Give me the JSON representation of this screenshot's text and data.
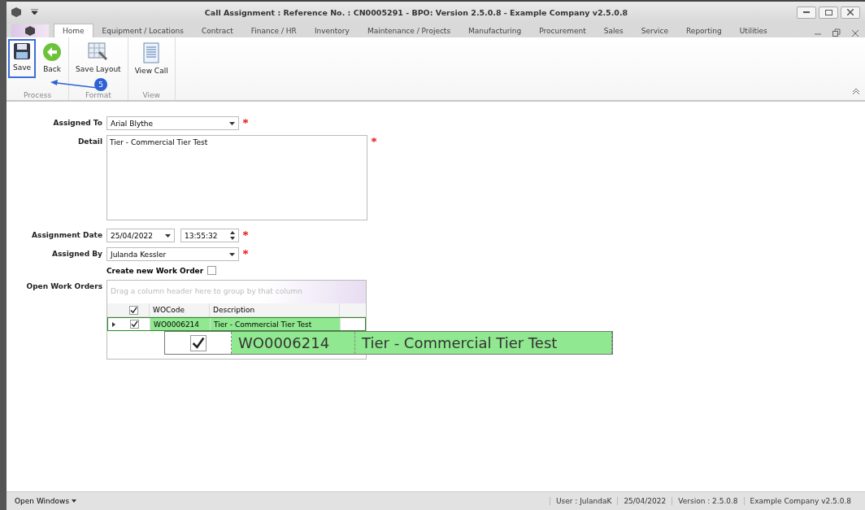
{
  "window": {
    "title": "Call Assignment : Reference No. : CN0005291 - BPO: Version 2.5.0.8 - Example Company v2.5.0.8"
  },
  "tabs": [
    {
      "label": "Home",
      "selected": true
    },
    {
      "label": "Equipment / Locations",
      "selected": false
    },
    {
      "label": "Contract",
      "selected": false
    },
    {
      "label": "Finance / HR",
      "selected": false
    },
    {
      "label": "Inventory",
      "selected": false
    },
    {
      "label": "Maintenance / Projects",
      "selected": false
    },
    {
      "label": "Manufacturing",
      "selected": false
    },
    {
      "label": "Procurement",
      "selected": false
    },
    {
      "label": "Sales",
      "selected": false
    },
    {
      "label": "Service",
      "selected": false
    },
    {
      "label": "Reporting",
      "selected": false
    },
    {
      "label": "Utilities",
      "selected": false
    }
  ],
  "ribbon": [
    {
      "group": "Process",
      "buttons": [
        {
          "label": "Save",
          "kind": "save",
          "highlighted": true
        },
        {
          "label": "Back",
          "kind": "back",
          "highlighted": false
        }
      ]
    },
    {
      "group": "Format",
      "buttons": [
        {
          "label": "Save Layout",
          "kind": "layout",
          "highlighted": false
        }
      ]
    },
    {
      "group": "View",
      "buttons": [
        {
          "label": "View Call",
          "kind": "document",
          "highlighted": false
        }
      ]
    }
  ],
  "annotation": {
    "number": "5"
  },
  "form": {
    "assigned_to": {
      "label": "Assigned To",
      "value": "Arial Blythe",
      "required": true
    },
    "detail": {
      "label": "Detail",
      "value": "Tier - Commercial Tier Test",
      "required": true
    },
    "assignment_date": {
      "label": "Assignment Date",
      "date": "25/04/2022",
      "time": "13:55:32",
      "required": true
    },
    "assigned_by": {
      "label": "Assigned By",
      "value": "Julanda Kessler",
      "required": true
    },
    "create_work_order": {
      "label": "Create new Work Order",
      "checked": false
    },
    "open_work_orders": {
      "label": "Open Work Orders",
      "group_hint": "Drag a column header here to group by that column",
      "columns": [
        {
          "kind": "check",
          "checked": true
        },
        {
          "kind": "text",
          "label": "WOCode"
        },
        {
          "kind": "text",
          "label": "Description"
        }
      ],
      "rows": [
        {
          "checked": true,
          "code": "WO0006214",
          "description": "Tier - Commercial Tier Test",
          "selected": true
        }
      ],
      "magnified_row": {
        "checked": true,
        "code": "WO0006214",
        "description": "Tier - Commercial Tier Test"
      }
    }
  },
  "status_bar": {
    "open_windows": "Open Windows",
    "items": [
      "User : JulandaK",
      "25/04/2022",
      "Version : 2.5.0.8",
      "Example Company v2.5.0.8"
    ]
  }
}
